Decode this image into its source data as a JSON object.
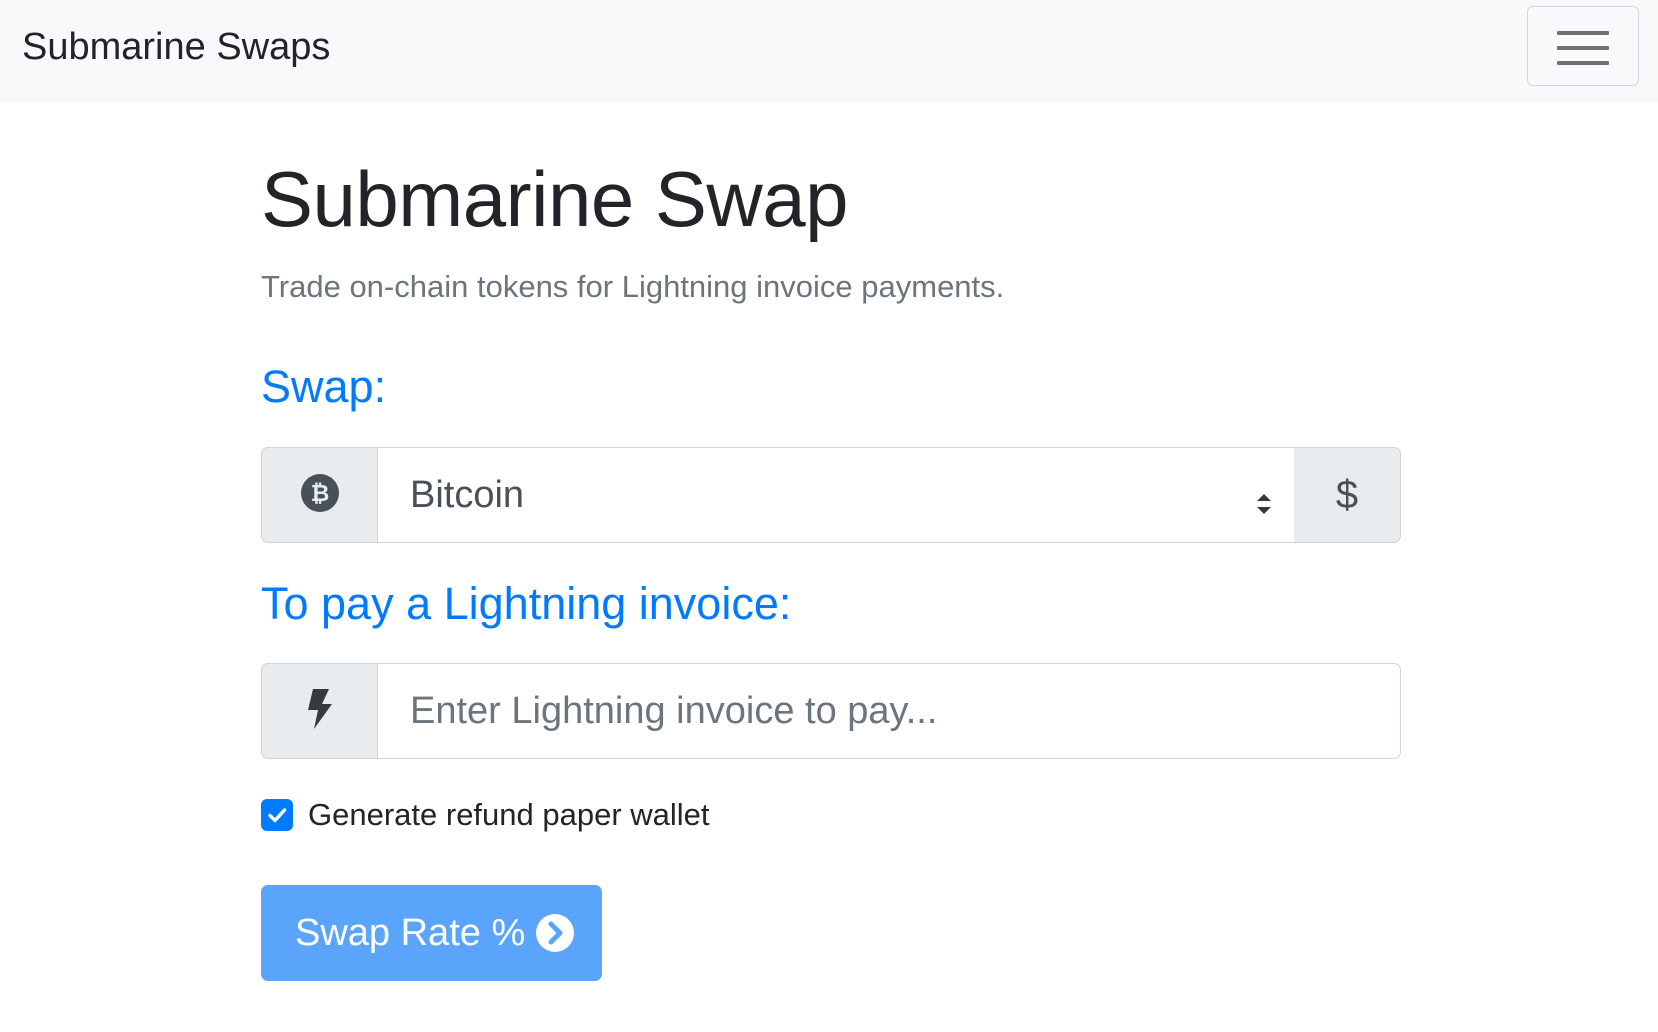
{
  "navbar": {
    "brand": "Submarine Swaps",
    "menu_icon": "hamburger-menu-icon"
  },
  "main": {
    "title": "Submarine Swap",
    "subtitle": "Trade on-chain tokens for Lightning invoice payments."
  },
  "swap": {
    "label": "Swap:",
    "left_icon": "bitcoin-icon",
    "selected_network": "Bitcoin",
    "right_addon": "$"
  },
  "invoice": {
    "label": "To pay a Lightning invoice:",
    "icon": "lightning-bolt-icon",
    "value": "",
    "placeholder": "Enter Lightning invoice to pay..."
  },
  "refund": {
    "checked": true,
    "label": "Generate refund paper wallet"
  },
  "submit": {
    "label": "Swap Rate %",
    "icon": "chevron-circle-right-icon"
  },
  "colors": {
    "accent": "#007bff",
    "button": "#5aa5fb",
    "navbar_bg": "#f8f9fa",
    "addon_bg": "#e9ecef",
    "muted_text": "#6c757d"
  }
}
